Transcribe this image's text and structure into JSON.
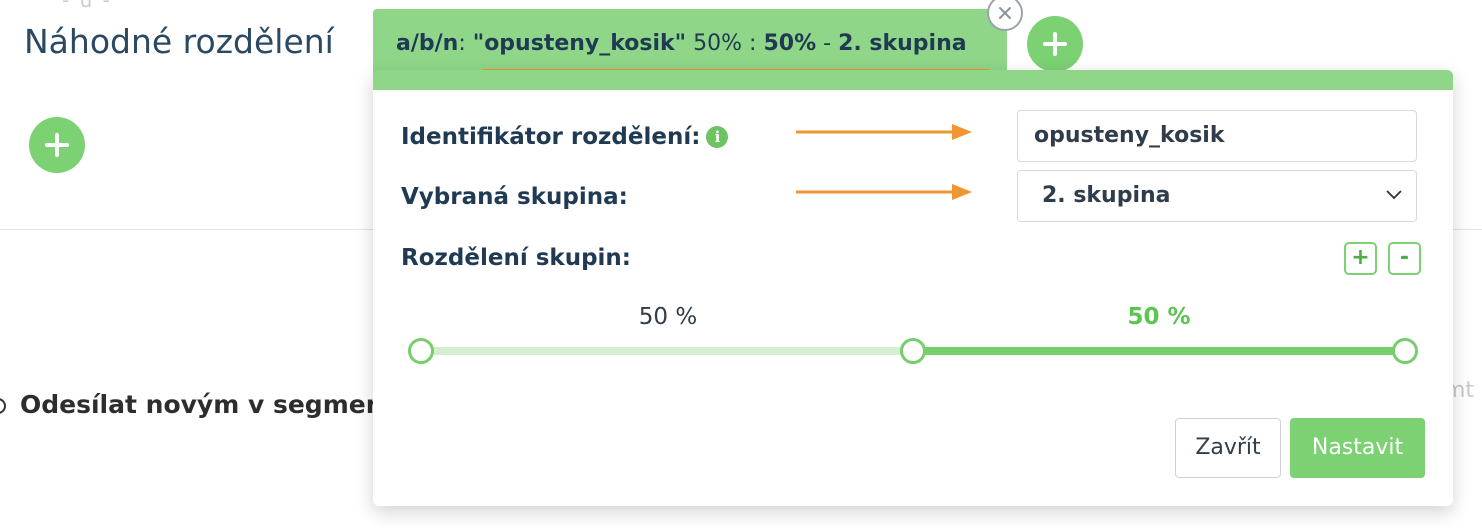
{
  "background": {
    "top_dash": "- u -",
    "page_title": "Náhodné rozdělení",
    "segment_option_text": "Odesílat novým v segmen",
    "right_fragment": "mt"
  },
  "tab": {
    "prefix": "a/b/n",
    "identifier": "\"opusteny_kosik\"",
    "first_pct": "50%",
    "separator": ":",
    "selected_pct": "50%",
    "dash": "-",
    "selected_group": "2. skupina"
  },
  "form": {
    "identifier_label": "Identifikátor rozdělení:",
    "identifier_value": "opusteny_kosik",
    "group_label": "Vybraná skupina:",
    "group_value": "2. skupina",
    "split_label": "Rozdělení skupin:",
    "add_group_label": "+",
    "remove_group_label": "-"
  },
  "split": {
    "groups": [
      {
        "label": "50 %",
        "fraction": 0.5,
        "selected": false
      },
      {
        "label": "50 %",
        "fraction": 0.5,
        "selected": true
      }
    ]
  },
  "buttons": {
    "close_label": "Zavřít",
    "submit_label": "Nastavit"
  },
  "colors": {
    "accent_green": "#7cd172",
    "tab_green": "#8fd689",
    "annotation_orange": "#f0952f",
    "text_dark": "#1f3a52"
  },
  "icons": [
    "plus-icon",
    "close-icon",
    "info-icon",
    "chevron-down-icon",
    "arrow-right-icon"
  ]
}
